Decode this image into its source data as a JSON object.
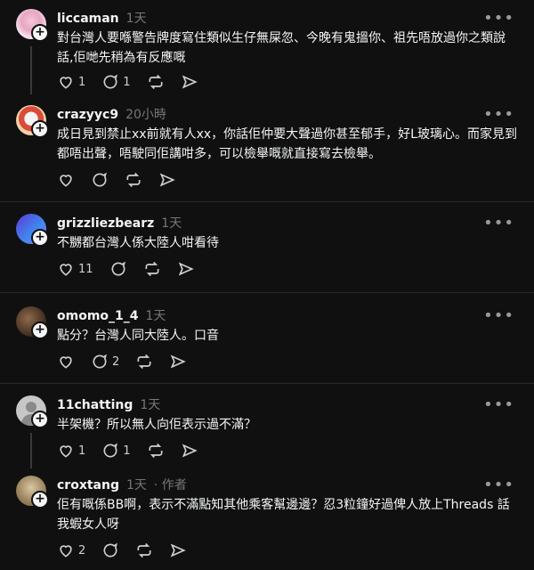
{
  "posts": [
    {
      "user": "liccaman",
      "time": "1天",
      "text": "對台灣人要喺警告牌度寫住類似生仔無屎忽、今晚有鬼搵你、祖先唔放過你之類說話,佢哋先稍為有反應嘅",
      "likes": "1",
      "replies": "1",
      "author": ""
    },
    {
      "user": "crazyyc9",
      "time": "20小時",
      "text": "成日見到禁止xx前就有人xx，你話佢仲要大聲過你甚至郁手，好L玻璃心。而家見到都唔出聲，唔駛同佢講咁多，可以檢舉嘅就直接寫去檢舉。",
      "likes": "",
      "replies": "",
      "author": ""
    },
    {
      "user": "grizzliezbearz",
      "time": "1天",
      "text": "不嬲都台灣人係大陸人咁看待",
      "likes": "11",
      "replies": "",
      "author": ""
    },
    {
      "user": "omomo_1_4",
      "time": "1天",
      "text": "點分？台灣人同大陸人。口音",
      "likes": "",
      "replies": "2",
      "author": ""
    },
    {
      "user": "11chatting",
      "time": "1天",
      "text": "半架機？所以無人向佢表示過不滿？",
      "likes": "1",
      "replies": "1",
      "author": ""
    },
    {
      "user": "croxtang",
      "time": "1天",
      "text": "佢有嘅係BB啊，表示不滿點知其他乘客幫邊邊？忍3粒鐘好過俾人放上Threads 話我蝦女人呀",
      "likes": "2",
      "replies": "",
      "author": "· 作者"
    }
  ],
  "icons": {
    "more": "more-icon",
    "like": "heart-icon",
    "reply": "comment-icon",
    "repost": "repost-icon",
    "share": "share-icon"
  }
}
